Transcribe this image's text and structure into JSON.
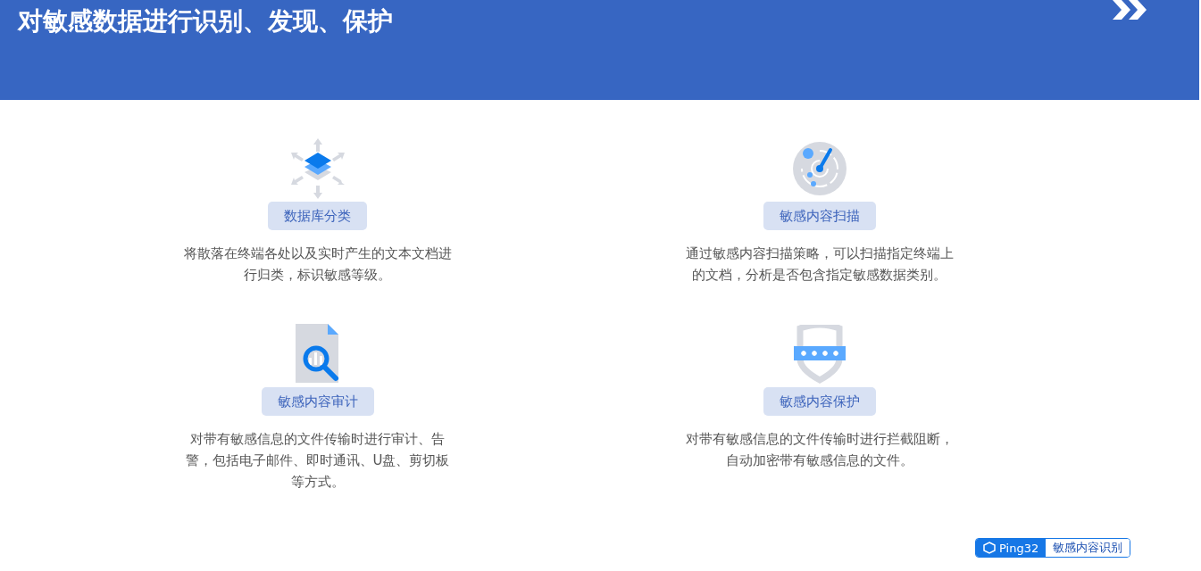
{
  "header": {
    "title": "对敏感数据进行识别、发现、保护"
  },
  "features": [
    {
      "kind": "classify",
      "label": "数据库分类",
      "description": "将散落在终端各处以及实时产生的文本文档进行归类，标识敏感等级。"
    },
    {
      "kind": "scan",
      "label": "敏感内容扫描",
      "description": "通过敏感内容扫描策略，可以扫描指定终端上的文档，分析是否包含指定敏感数据类别。"
    },
    {
      "kind": "audit",
      "label": "敏感内容审计",
      "description": "对带有敏感信息的文件传输时进行审计、告警，包括电子邮件、即时通讯、U盘、剪切板等方式。"
    },
    {
      "kind": "protect",
      "label": "敏感内容保护",
      "description": "对带有敏感信息的文件传输时进行拦截阻断，自动加密带有敏感信息的文件。"
    }
  ],
  "badge": {
    "brand": "Ping32",
    "label": "敏感内容识别"
  }
}
